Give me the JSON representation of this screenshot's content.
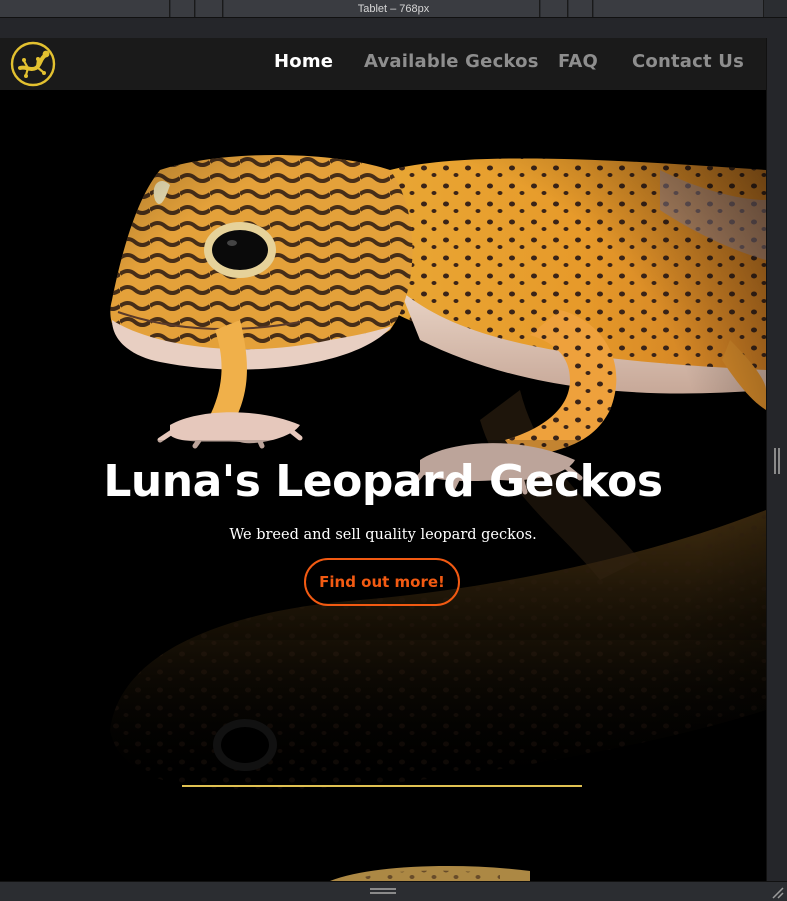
{
  "editor": {
    "viewport_label": "Tablet – 768px"
  },
  "nav": {
    "logo_icon": "gecko-icon",
    "items": [
      {
        "label": "Home",
        "active": true
      },
      {
        "label": "Available Geckos",
        "active": false
      },
      {
        "label": "FAQ",
        "active": false
      },
      {
        "label": "Contact Us",
        "active": false
      }
    ]
  },
  "hero": {
    "title": "Luna's Leopard Geckos",
    "subtitle": "We breed and sell quality leopard geckos.",
    "cta_label": "Find out more!"
  },
  "colors": {
    "accent": "#f25a12",
    "divider": "#e0c152",
    "logo": "#e3c130",
    "nav_bg": "#1a1a1a"
  }
}
